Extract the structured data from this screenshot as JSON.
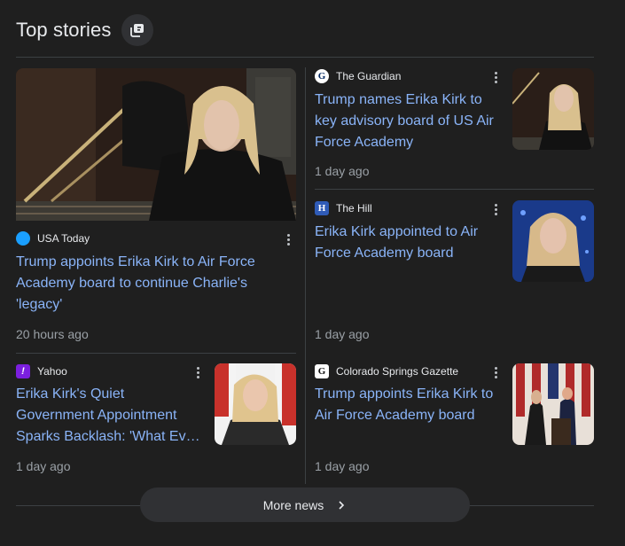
{
  "header": {
    "title": "Top stories"
  },
  "more_news": {
    "label": "More news"
  },
  "colors": {
    "link": "#8ab4f8",
    "meta": "#9aa0a6",
    "background": "#1f1f1f"
  },
  "stories": {
    "main": {
      "source": "USA Today",
      "favicon": "usatoday-icon",
      "headline": "Trump appoints Erika Kirk to Air Force Academy board to continue Charlie's 'legacy'",
      "time": "20 hours ago"
    },
    "guardian": {
      "source": "The Guardian",
      "favicon": "guardian-icon",
      "headline": "Trump names Erika Kirk to key advisory board of US Air Force Academy",
      "time": "1 day ago"
    },
    "hill": {
      "source": "The Hill",
      "favicon": "hill-icon",
      "headline": "Erika Kirk appointed to Air Force Academy board",
      "time": "1 day ago"
    },
    "yahoo": {
      "source": "Yahoo",
      "favicon": "yahoo-icon",
      "headline_line1": "Erika Kirk's Quiet",
      "headline_line2": "Government Appointment",
      "headline_line3": "Sparks Backlash: 'What Ev…",
      "time": "1 day ago"
    },
    "gazette": {
      "source": "Colorado Springs Gazette",
      "favicon": "gazette-icon",
      "headline": "Trump appoints Erika Kirk to Air Force Academy board",
      "time": "1 day ago"
    }
  }
}
